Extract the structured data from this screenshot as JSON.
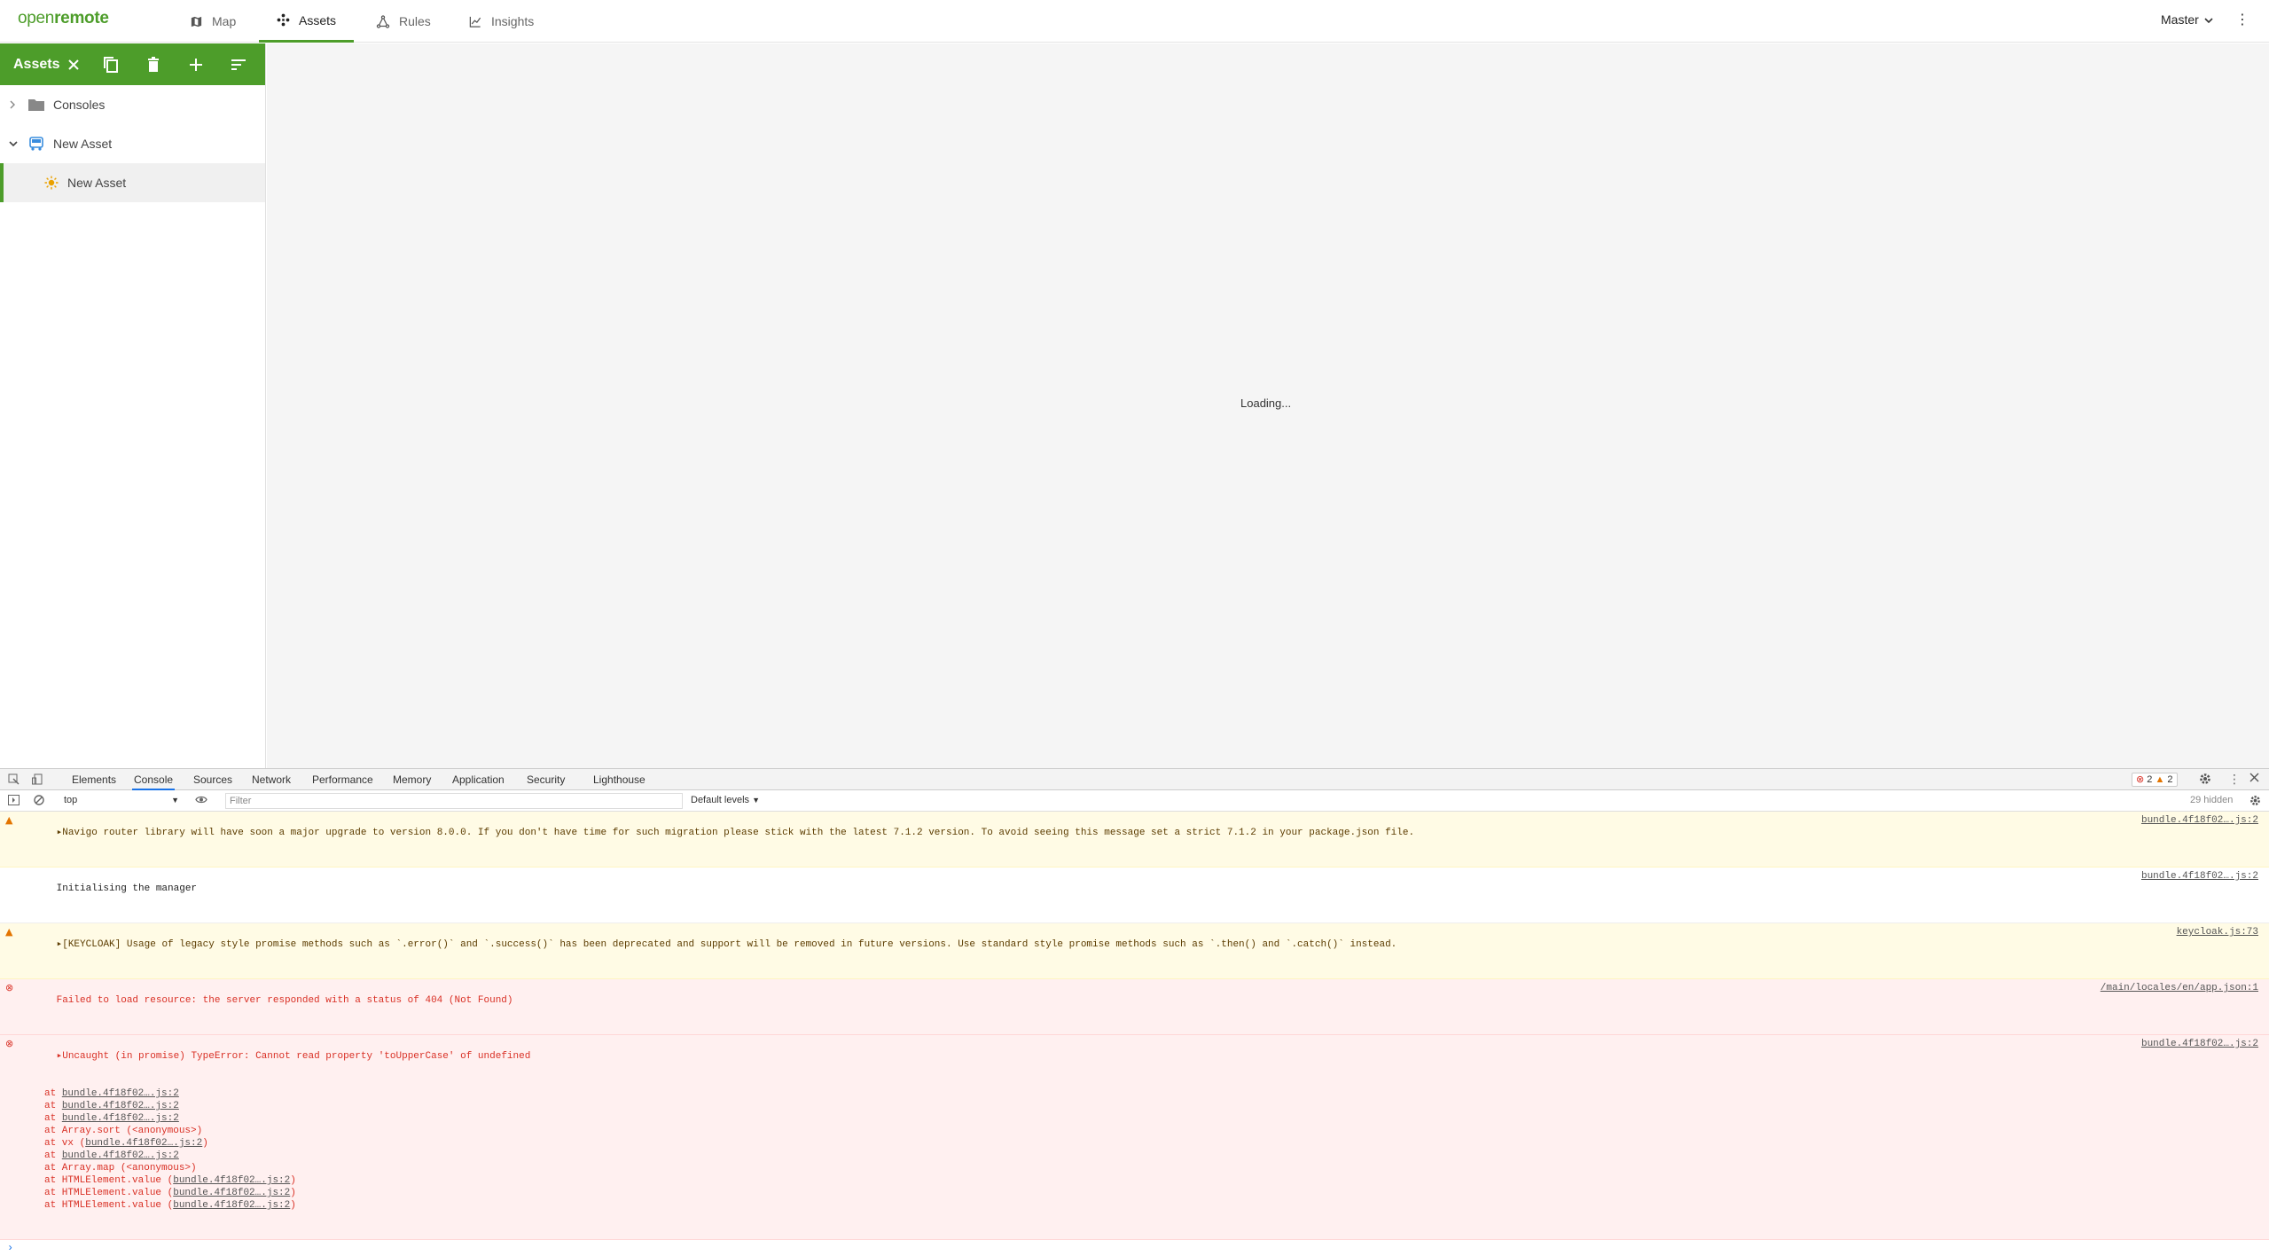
{
  "header": {
    "logo_part1": "open",
    "logo_part2": "remote",
    "nav": [
      {
        "label": "Map",
        "icon": "map-icon"
      },
      {
        "label": "Assets",
        "icon": "assets-icon"
      },
      {
        "label": "Rules",
        "icon": "rules-icon"
      },
      {
        "label": "Insights",
        "icon": "insights-icon"
      }
    ],
    "realm": "Master"
  },
  "sidebar": {
    "title": "Assets",
    "tree": [
      {
        "label": "Consoles",
        "icon": "folder-icon",
        "expanded": false
      },
      {
        "label": "New Asset",
        "icon": "vehicle-icon",
        "expanded": true
      },
      {
        "label": "New Asset",
        "icon": "sun-icon",
        "selected": true
      }
    ]
  },
  "main": {
    "loading_text": "Loading..."
  },
  "devtools": {
    "tabs": [
      "Elements",
      "Console",
      "Sources",
      "Network",
      "Performance",
      "Memory",
      "Application",
      "Security",
      "Lighthouse"
    ],
    "active_tab": "Console",
    "error_count": "2",
    "warning_count": "2",
    "context": "top",
    "filter_placeholder": "Filter",
    "levels": "Default levels",
    "hidden": "29 hidden",
    "messages": [
      {
        "level": "warning",
        "text": "Navigo router library will have soon a major upgrade to version 8.0.0. If you don't have time for such migration please stick with the latest 7.1.2 version. To avoid seeing this message set a strict 7.1.2 in your package.json file.",
        "source": "bundle.4f18f02….js:2"
      },
      {
        "level": "info",
        "text": "Initialising the manager",
        "source": "bundle.4f18f02….js:2"
      },
      {
        "level": "warning",
        "text": "[KEYCLOAK] Usage of legacy style promise methods such as `.error()` and `.success()` has been deprecated and support will be removed in future versions. Use standard style promise methods such as `.then() and `.catch()` instead.",
        "source": "keycloak.js:73"
      },
      {
        "level": "error",
        "text": "Failed to load resource: the server responded with a status of 404 (Not Found)",
        "source": "/main/locales/en/app.json:1"
      },
      {
        "level": "error",
        "text": "Uncaught (in promise) TypeError: Cannot read property 'toUpperCase' of undefined",
        "source": "bundle.4f18f02….js:2"
      }
    ],
    "stack": [
      {
        "prefix": "at ",
        "link": "bundle.4f18f02….js:2",
        "suffix": ""
      },
      {
        "prefix": "at ",
        "link": "bundle.4f18f02….js:2",
        "suffix": ""
      },
      {
        "prefix": "at ",
        "link": "bundle.4f18f02….js:2",
        "suffix": ""
      },
      {
        "prefix": "at Array.sort (<anonymous>)",
        "link": "",
        "suffix": ""
      },
      {
        "prefix": "at vx (",
        "link": "bundle.4f18f02….js:2",
        "suffix": ")"
      },
      {
        "prefix": "at ",
        "link": "bundle.4f18f02….js:2",
        "suffix": ""
      },
      {
        "prefix": "at Array.map (<anonymous>)",
        "link": "",
        "suffix": ""
      },
      {
        "prefix": "at HTMLElement.value (",
        "link": "bundle.4f18f02….js:2",
        "suffix": ")"
      },
      {
        "prefix": "at HTMLElement.value (",
        "link": "bundle.4f18f02….js:2",
        "suffix": ")"
      },
      {
        "prefix": "at HTMLElement.value (",
        "link": "bundle.4f18f02….js:2",
        "suffix": ")"
      }
    ],
    "prompt": "›"
  },
  "colors": {
    "brand": "#4d9d2a",
    "error": "#d93025",
    "warning": "#e37400"
  }
}
